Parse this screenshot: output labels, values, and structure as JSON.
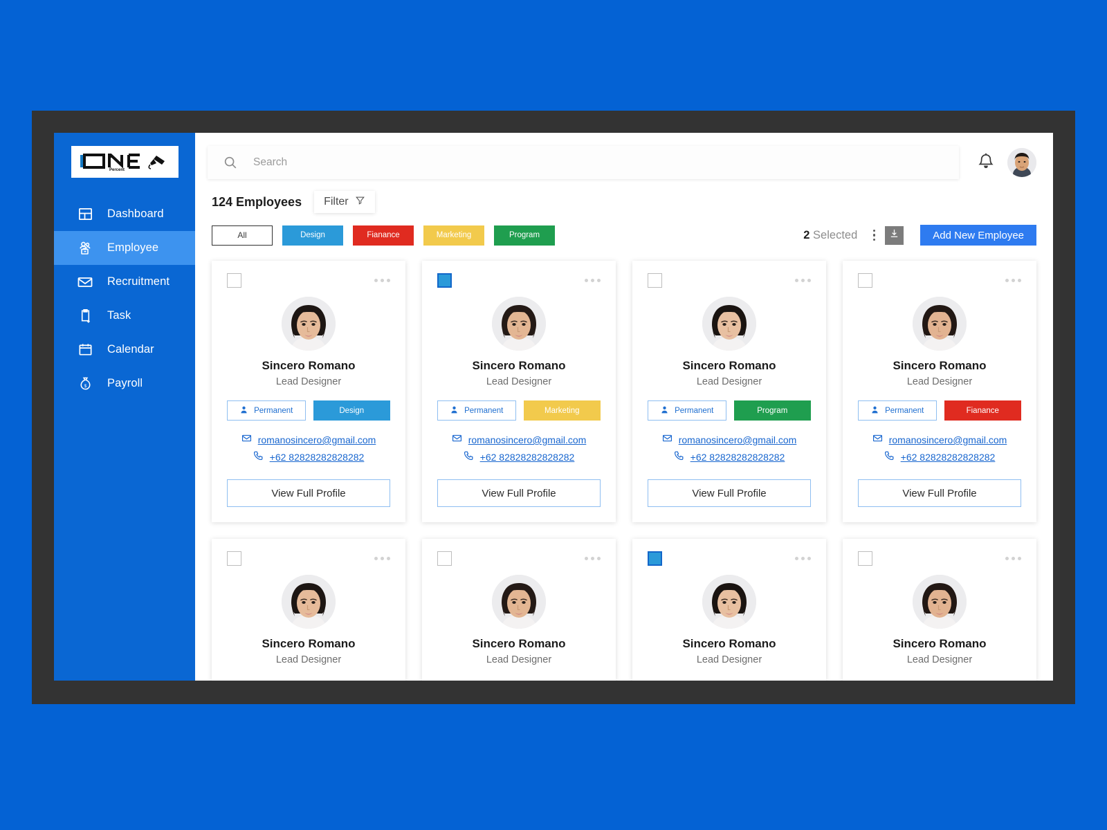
{
  "theme": {
    "page_background": "#0462d4",
    "frame": "#333333",
    "sidebar": "#0a67d3",
    "sidebar_active": "#3d93ef",
    "accent_blue": "#2e7bf0",
    "link_blue": "#1866cf"
  },
  "sidebar": {
    "logo": {
      "name": "ONE",
      "subtext": "Percent",
      "icon": "pen-icon"
    },
    "items": [
      {
        "label": "Dashboard",
        "icon": "dashboard-icon",
        "active": false
      },
      {
        "label": "Employee",
        "icon": "employees-icon",
        "active": true
      },
      {
        "label": "Recruitment",
        "icon": "envelope-icon",
        "active": false
      },
      {
        "label": "Task",
        "icon": "clipboard-add-icon",
        "active": false
      },
      {
        "label": "Calendar",
        "icon": "calendar-icon",
        "active": false
      },
      {
        "label": "Payroll",
        "icon": "money-bag-icon",
        "active": false
      }
    ]
  },
  "topbar": {
    "search": {
      "placeholder": "Search",
      "value": "",
      "icon": "search-icon"
    },
    "bell_icon": "bell-icon",
    "avatar": "user-avatar"
  },
  "toolbar": {
    "employee_count": "124 Employees",
    "filter_label": "Filter",
    "filter_icon": "filter-icon",
    "selected_count": "2",
    "selected_label": "Selected",
    "kebab_icon": "more-vertical-icon",
    "download_icon": "download-icon",
    "add_label": "Add New Employee"
  },
  "tabs": [
    {
      "label": "All",
      "color": "#ffffff",
      "text_color": "#3a3a3a",
      "active": true
    },
    {
      "label": "Design",
      "color": "#2b9ad9",
      "text_color": "#ffffff",
      "active": false
    },
    {
      "label": "Fianance",
      "color": "#e02b20",
      "text_color": "#ffffff",
      "active": false
    },
    {
      "label": "Marketing",
      "color": "#f2ca4c",
      "text_color": "#ffffff",
      "active": false
    },
    {
      "label": "Program",
      "color": "#1f9e4f",
      "text_color": "#ffffff",
      "active": false
    }
  ],
  "card_common": {
    "permanent_label": "Permanent",
    "permanent_icon": "person-icon",
    "email_icon": "envelope-icon",
    "phone_icon": "phone-icon",
    "profile_button": "View Full Profile"
  },
  "employees": [
    {
      "name": "Sincero Romano",
      "role": "Lead Designer",
      "selected": false,
      "department": "Design",
      "dept_color": "#2b9ad9",
      "email": "romanosincero@gmail.com",
      "phone": "+62 82828282828282",
      "face": "f1"
    },
    {
      "name": "Sincero Romano",
      "role": "Lead Designer",
      "selected": true,
      "department": "Marketing",
      "dept_color": "#f2ca4c",
      "email": "romanosincero@gmail.com",
      "phone": "+62 82828282828282",
      "face": "f2"
    },
    {
      "name": "Sincero Romano",
      "role": "Lead Designer",
      "selected": false,
      "department": "Program",
      "dept_color": "#1f9e4f",
      "email": "romanosincero@gmail.com",
      "phone": "+62 82828282828282",
      "face": "f3"
    },
    {
      "name": "Sincero Romano",
      "role": "Lead Designer",
      "selected": false,
      "department": "Fianance",
      "dept_color": "#e02b20",
      "email": "romanosincero@gmail.com",
      "phone": "+62 82828282828282",
      "face": "f4"
    },
    {
      "name": "Sincero Romano",
      "role": "Lead Designer",
      "selected": false,
      "department": "",
      "dept_color": "",
      "email": "",
      "phone": "",
      "face": "f1"
    },
    {
      "name": "Sincero Romano",
      "role": "Lead Designer",
      "selected": false,
      "department": "",
      "dept_color": "",
      "email": "",
      "phone": "",
      "face": "f2"
    },
    {
      "name": "Sincero Romano",
      "role": "Lead Designer",
      "selected": true,
      "department": "",
      "dept_color": "",
      "email": "",
      "phone": "",
      "face": "f3"
    },
    {
      "name": "Sincero Romano",
      "role": "Lead Designer",
      "selected": false,
      "department": "",
      "dept_color": "",
      "email": "",
      "phone": "",
      "face": "f4"
    }
  ]
}
